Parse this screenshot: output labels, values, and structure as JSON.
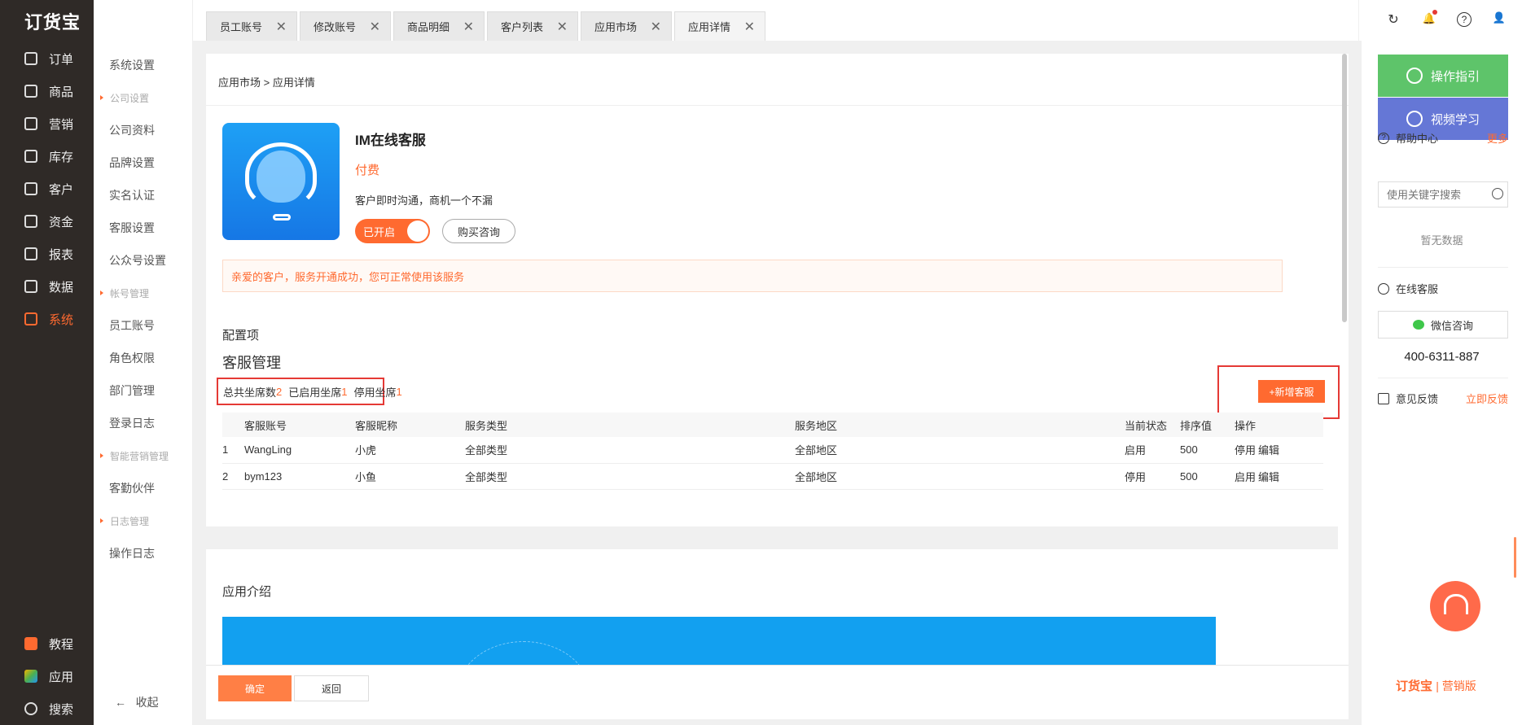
{
  "nav": {
    "logo": "订货宝",
    "items": [
      {
        "label": "订单",
        "icon": "order-icon"
      },
      {
        "label": "商品",
        "icon": "goods-icon"
      },
      {
        "label": "营销",
        "icon": "marketing-icon"
      },
      {
        "label": "库存",
        "icon": "warehouse-icon"
      },
      {
        "label": "客户",
        "icon": "customer-icon"
      },
      {
        "label": "资金",
        "icon": "money-icon"
      },
      {
        "label": "报表",
        "icon": "report-icon"
      },
      {
        "label": "数据",
        "icon": "data-icon"
      },
      {
        "label": "系统",
        "icon": "system-icon"
      }
    ],
    "bottom": [
      {
        "label": "教程",
        "icon": "tutorial-icon"
      },
      {
        "label": "应用",
        "icon": "app-icon"
      },
      {
        "label": "搜索",
        "icon": "search-icon"
      }
    ],
    "active_color": "#ff6a30"
  },
  "submenu": {
    "items": [
      "系统设置",
      "公司设置",
      "公司资料",
      "品牌设置",
      "实名认证",
      "客服设置",
      "公众号设置",
      "帐号管理",
      "员工账号",
      "角色权限",
      "部门管理",
      "登录日志",
      "智能营销管理",
      "客勤伙伴",
      "日志管理",
      "操作日志"
    ],
    "collapse_label": "收起",
    "collapse_arrow": "←"
  },
  "tabs": [
    {
      "label": "员工账号",
      "close": "✕"
    },
    {
      "label": "修改账号",
      "close": "✕"
    },
    {
      "label": "商品明细",
      "close": "✕"
    },
    {
      "label": "客户列表",
      "close": "✕"
    },
    {
      "label": "应用市场",
      "close": "✕"
    },
    {
      "label": "应用详情",
      "close": "✕"
    }
  ],
  "topbar": {
    "refresh": "↻",
    "bell": "🔔",
    "help": "?",
    "user": "👤"
  },
  "breadcrumb": "应用市场 > 应用详情",
  "app": {
    "title": "IM在线客服",
    "price": "付费",
    "desc": "客户即时沟通，商机一个不漏",
    "toggle_label": "已开启",
    "consult_label": "购买咨询",
    "notice": "亲爱的客户，服务开通成功，您可正常使用该服务"
  },
  "config": {
    "section_label": "配置项",
    "title": "客服管理",
    "stats": {
      "total_label": "总共坐席数",
      "total": "2",
      "enabled_label": "已启用坐席",
      "enabled": "1",
      "disabled_label": "停用坐席",
      "disabled": "1"
    },
    "add_button": "+新增客服",
    "columns": [
      "客服账号",
      "客服昵称",
      "服务类型",
      "服务地区",
      "当前状态",
      "排序值",
      "操作"
    ],
    "rows": [
      {
        "no": "1",
        "account": "WangLing",
        "nickname": "小虎",
        "type": "全部类型",
        "region": "全部地区",
        "status": "启用",
        "sort": "500",
        "op1": "停用",
        "op2": "编辑"
      },
      {
        "no": "2",
        "account": "bym123",
        "nickname": "小鱼",
        "type": "全部类型",
        "region": "全部地区",
        "status": "停用",
        "sort": "500",
        "op1": "启用",
        "op2": "编辑"
      }
    ]
  },
  "intro_label": "应用介绍",
  "footer": {
    "confirm": "确定",
    "back": "返回"
  },
  "right_panel": {
    "guide": "操作指引",
    "video": "视频学习",
    "help_center": "帮助中心",
    "more": "更多",
    "search_placeholder": "使用关键字搜索",
    "empty": "暂无数据",
    "online_service": "在线客服",
    "wechat": "微信咨询",
    "phone": "400-6311-887",
    "feedback": "意见反馈",
    "feedback_now": "立即反馈",
    "brand": "订货宝",
    "brand_suffix": "| 营销版"
  }
}
